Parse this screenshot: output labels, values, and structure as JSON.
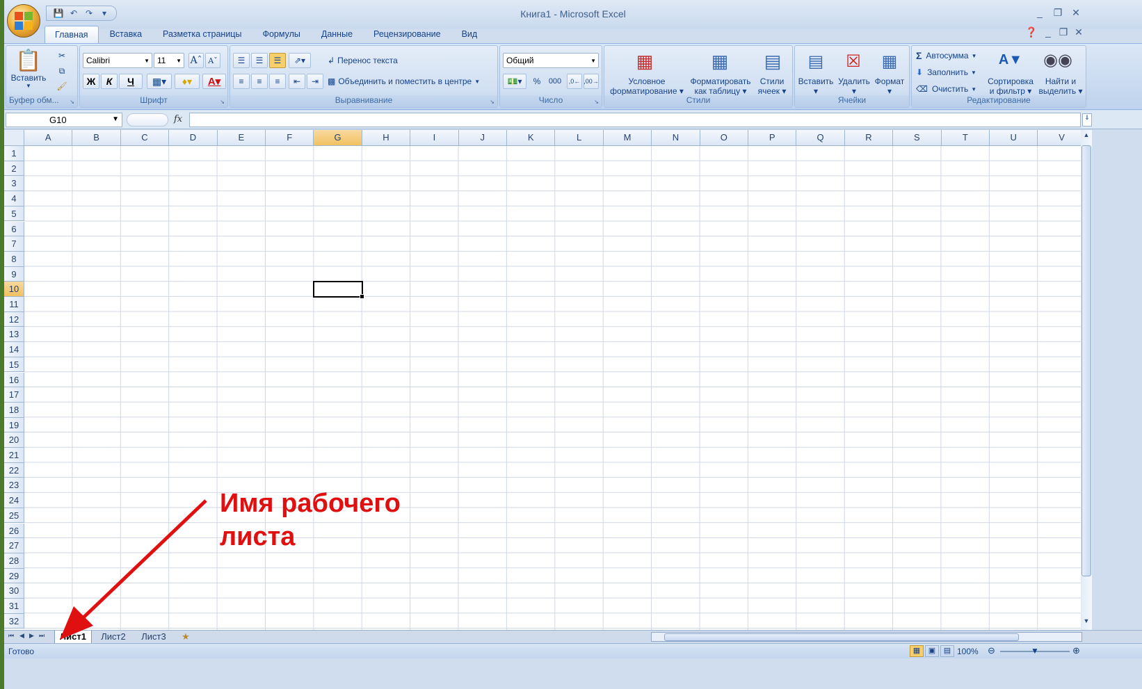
{
  "window": {
    "title": "Книга1 - Microsoft Excel"
  },
  "tabs": [
    "Главная",
    "Вставка",
    "Разметка страницы",
    "Формулы",
    "Данные",
    "Рецензирование",
    "Вид"
  ],
  "clipboard": {
    "paste": "Вставить",
    "label": "Буфер обм..."
  },
  "font": {
    "name": "Calibri",
    "size": "11",
    "bold": "Ж",
    "italic": "К",
    "underline": "Ч",
    "label": "Шрифт"
  },
  "alignment": {
    "wrap": "Перенос текста",
    "merge": "Объединить и поместить в центре",
    "label": "Выравнивание"
  },
  "number": {
    "format": "Общий",
    "percent": "%",
    "thousands": "000",
    "label": "Число"
  },
  "styles": {
    "conditional": [
      "Условное",
      "форматирование"
    ],
    "as_table": [
      "Форматировать",
      "как таблицу"
    ],
    "cell_styles": [
      "Стили",
      "ячеек"
    ],
    "label": "Стили"
  },
  "cells": {
    "insert": "Вставить",
    "delete": "Удалить",
    "format": "Формат",
    "label": "Ячейки"
  },
  "editing": {
    "autosum": "Автосумма",
    "fill": "Заполнить",
    "clear": "Очистить",
    "sort": [
      "Сортировка",
      "и фильтр"
    ],
    "find": [
      "Найти и",
      "выделить"
    ],
    "label": "Редактирование"
  },
  "formula_bar": {
    "name_box": "G10",
    "fx": "fx",
    "value": ""
  },
  "columns": [
    "A",
    "B",
    "C",
    "D",
    "E",
    "F",
    "G",
    "H",
    "I",
    "J",
    "K",
    "L",
    "M",
    "N",
    "O",
    "P",
    "Q",
    "R",
    "S",
    "T",
    "U",
    "V"
  ],
  "selected_column": "G",
  "rows": [
    "1",
    "2",
    "3",
    "4",
    "5",
    "6",
    "7",
    "8",
    "9",
    "10",
    "11",
    "12",
    "13",
    "14",
    "15",
    "16",
    "17",
    "18",
    "19",
    "20",
    "21",
    "22",
    "23",
    "24",
    "25",
    "26",
    "27",
    "28",
    "29",
    "30",
    "31",
    "32"
  ],
  "selected_row": "10",
  "sheets": [
    "Лист1",
    "Лист2",
    "Лист3"
  ],
  "active_sheet": "Лист1",
  "status": {
    "ready": "Готово",
    "zoom": "100%"
  },
  "annotation": {
    "line1": "Имя рабочего",
    "line2": "листа",
    "color": "#e01010"
  }
}
